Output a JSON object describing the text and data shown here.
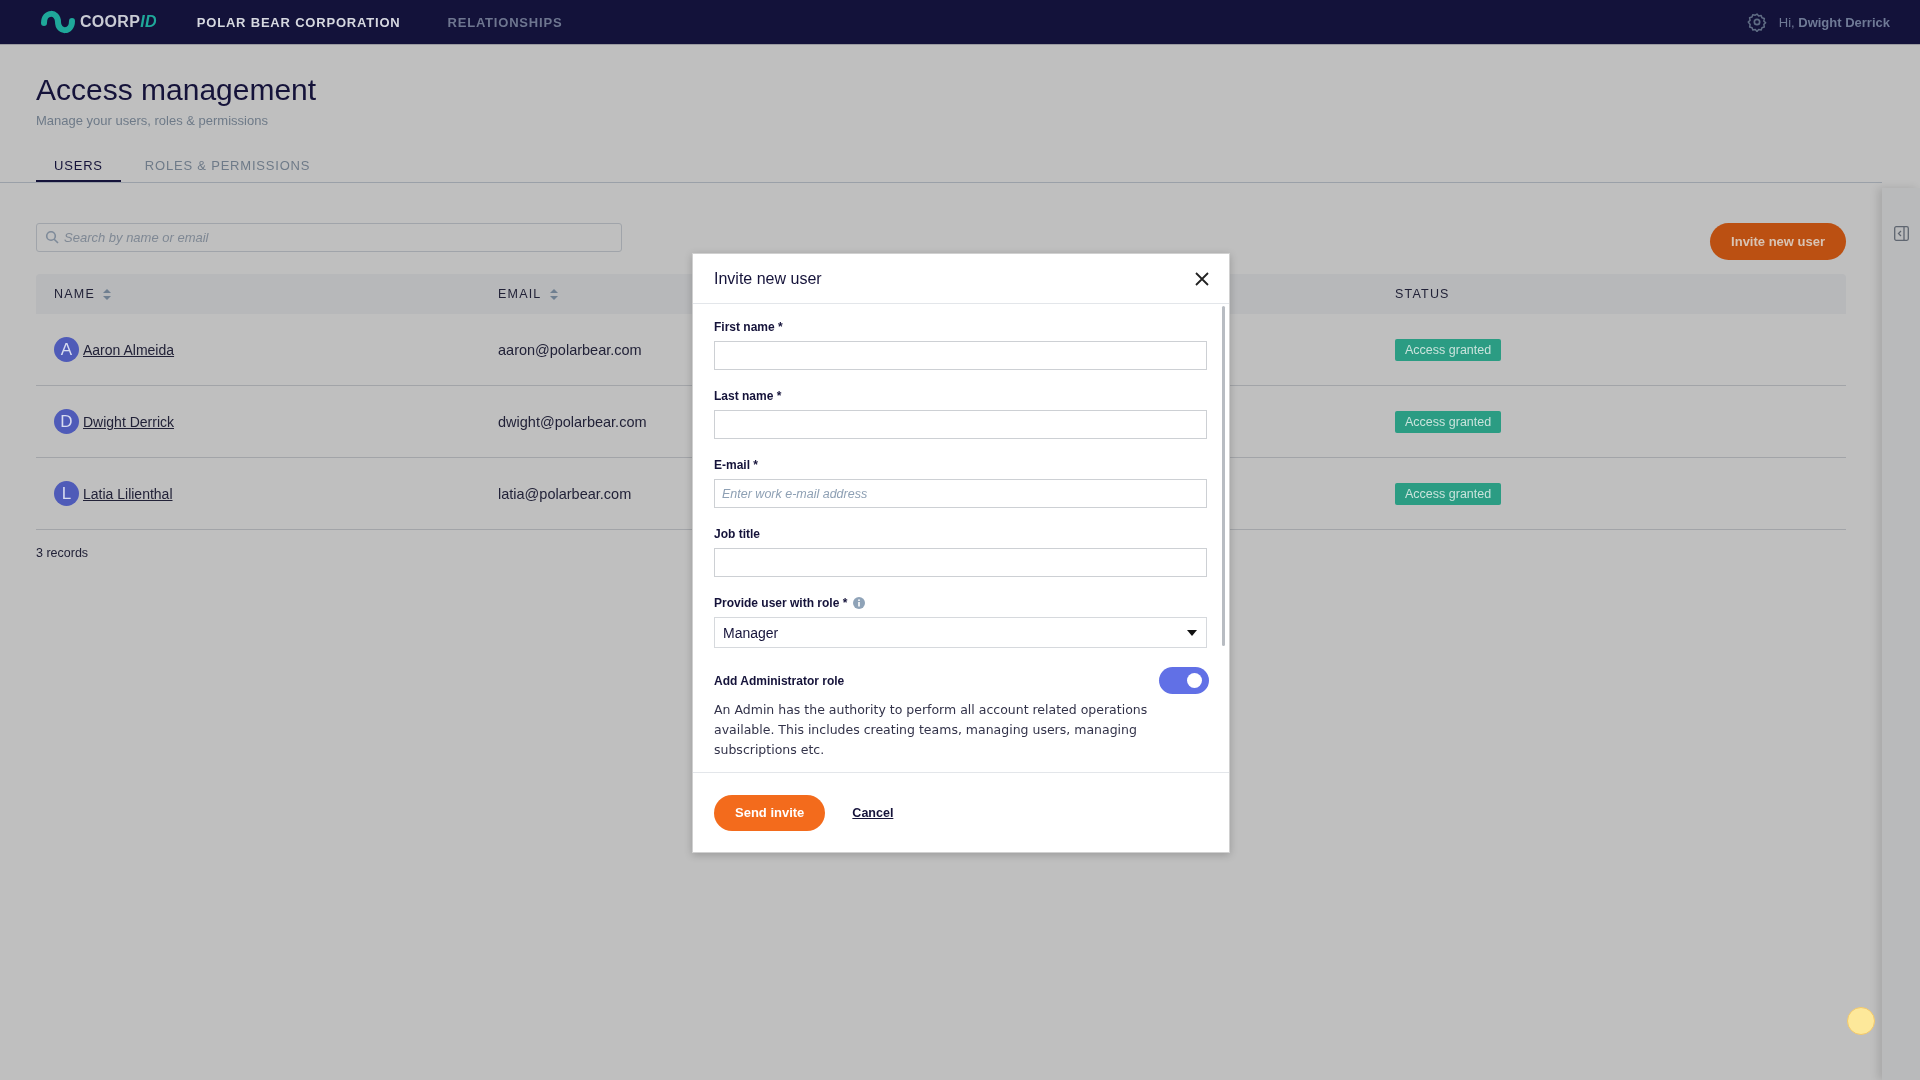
{
  "header": {
    "logo": {
      "text": "COORP",
      "accent": "ID"
    },
    "nav": [
      {
        "label": "POLAR BEAR CORPORATION",
        "selected": true
      },
      {
        "label": "RELATIONSHIPS",
        "selected": false
      }
    ],
    "greeting": "Hi,",
    "user": "Dwight Derrick"
  },
  "page": {
    "title": "Access management",
    "subtitle": "Manage your users, roles & permissions"
  },
  "tabs": [
    {
      "label": "USERS",
      "selected": true
    },
    {
      "label": "ROLES & PERMISSIONS",
      "selected": false
    }
  ],
  "search": {
    "placeholder": "Search by name or email"
  },
  "invite_button": "Invite new user",
  "table": {
    "columns": [
      {
        "label": "NAME",
        "sortable": true
      },
      {
        "label": "EMAIL",
        "sortable": true
      },
      {
        "label": "STATUS",
        "sortable": false
      }
    ],
    "rows": [
      {
        "initial": "A",
        "name": "Aaron Almeida",
        "email": "aaron@polarbear.com",
        "status": "Access granted"
      },
      {
        "initial": "D",
        "name": "Dwight Derrick",
        "email": "dwight@polarbear.com",
        "status": "Access granted"
      },
      {
        "initial": "L",
        "name": "Latia Lilienthal",
        "email": "latia@polarbear.com",
        "status": "Access granted"
      }
    ],
    "count": "3 records"
  },
  "dialog": {
    "title": "Invite new user",
    "fields": [
      {
        "kind": "text",
        "label": "First name *"
      },
      {
        "kind": "text",
        "label": "Last name *"
      },
      {
        "kind": "text",
        "label": "E-mail *",
        "placeholder": "Enter work e-mail address"
      },
      {
        "kind": "text",
        "label": "Job title"
      },
      {
        "kind": "select",
        "label": "Provide user with role *",
        "info": true,
        "value": "Manager"
      },
      {
        "kind": "toggle",
        "label": "Add Administrator role",
        "on": true,
        "description": "An Admin has the authority to perform all account related operations available. This includes creating teams, managing users, managing subscriptions etc."
      }
    ],
    "buttons": {
      "primary": "Send invite",
      "secondary": "Cancel"
    }
  }
}
